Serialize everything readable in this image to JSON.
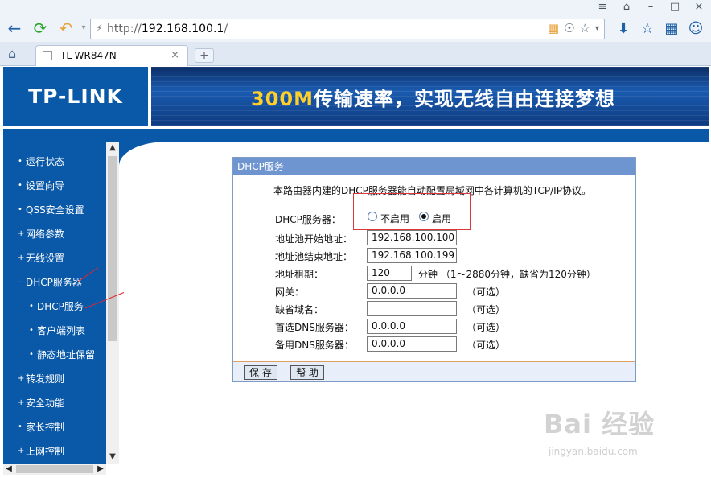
{
  "browser": {
    "url_prefix": "http://",
    "url_host": "192.168.100.1",
    "url_suffix": "/",
    "tab_title": "TL-WR847N",
    "tab_close": "×",
    "new_tab": "+",
    "window_controls": [
      "≡",
      "⌂",
      "–",
      "□",
      "×"
    ],
    "toolbar_icons": [
      "download-icon",
      "star-icon",
      "apps-icon",
      "user-icon"
    ]
  },
  "banner": {
    "logo_text": "TP-LINK",
    "slogan_highlight": "300M",
    "slogan_rest": "传输速率，实现无线自由连接梦想"
  },
  "menu": {
    "items": [
      {
        "bullet": "•",
        "label": "运行状态"
      },
      {
        "bullet": "•",
        "label": "设置向导"
      },
      {
        "bullet": "•",
        "label": "QSS安全设置"
      },
      {
        "bullet": "+",
        "label": "网络参数"
      },
      {
        "bullet": "+",
        "label": "无线设置"
      },
      {
        "bullet": "–",
        "label": "DHCP服务器"
      },
      {
        "bullet": "•",
        "label": "DHCP服务",
        "sub": true
      },
      {
        "bullet": "•",
        "label": "客户端列表",
        "sub": true
      },
      {
        "bullet": "•",
        "label": "静态地址保留",
        "sub": true
      },
      {
        "bullet": "+",
        "label": "转发规则"
      },
      {
        "bullet": "+",
        "label": "安全功能"
      },
      {
        "bullet": "•",
        "label": "家长控制"
      },
      {
        "bullet": "+",
        "label": "上网控制"
      }
    ]
  },
  "dhcp": {
    "panel_title": "DHCP服务",
    "description": "本路由器内建的DHCP服务器能自动配置局域网中各计算机的TCP/IP协议。",
    "server_label": "DHCP服务器：",
    "option_disable": "不启用",
    "option_enable": "启用",
    "pool_start_label": "地址池开始地址：",
    "pool_start_value": "192.168.100.100",
    "pool_end_label": "地址池结束地址：",
    "pool_end_value": "192.168.100.199",
    "lease_label": "地址租期：",
    "lease_value": "120",
    "lease_hint": "分钟 （1～2880分钟，缺省为120分钟）",
    "gateway_label": "网关：",
    "gateway_value": "0.0.0.0",
    "domain_label": "缺省域名：",
    "domain_value": "",
    "dns1_label": "首选DNS服务器：",
    "dns1_value": "0.0.0.0",
    "dns2_label": "备用DNS服务器：",
    "dns2_value": "0.0.0.0",
    "optional": "（可选）",
    "save_button": "保 存",
    "help_button": "帮 助"
  },
  "watermark": {
    "line1": "Bai 经验",
    "line2": "jingyan.baidu.com"
  }
}
